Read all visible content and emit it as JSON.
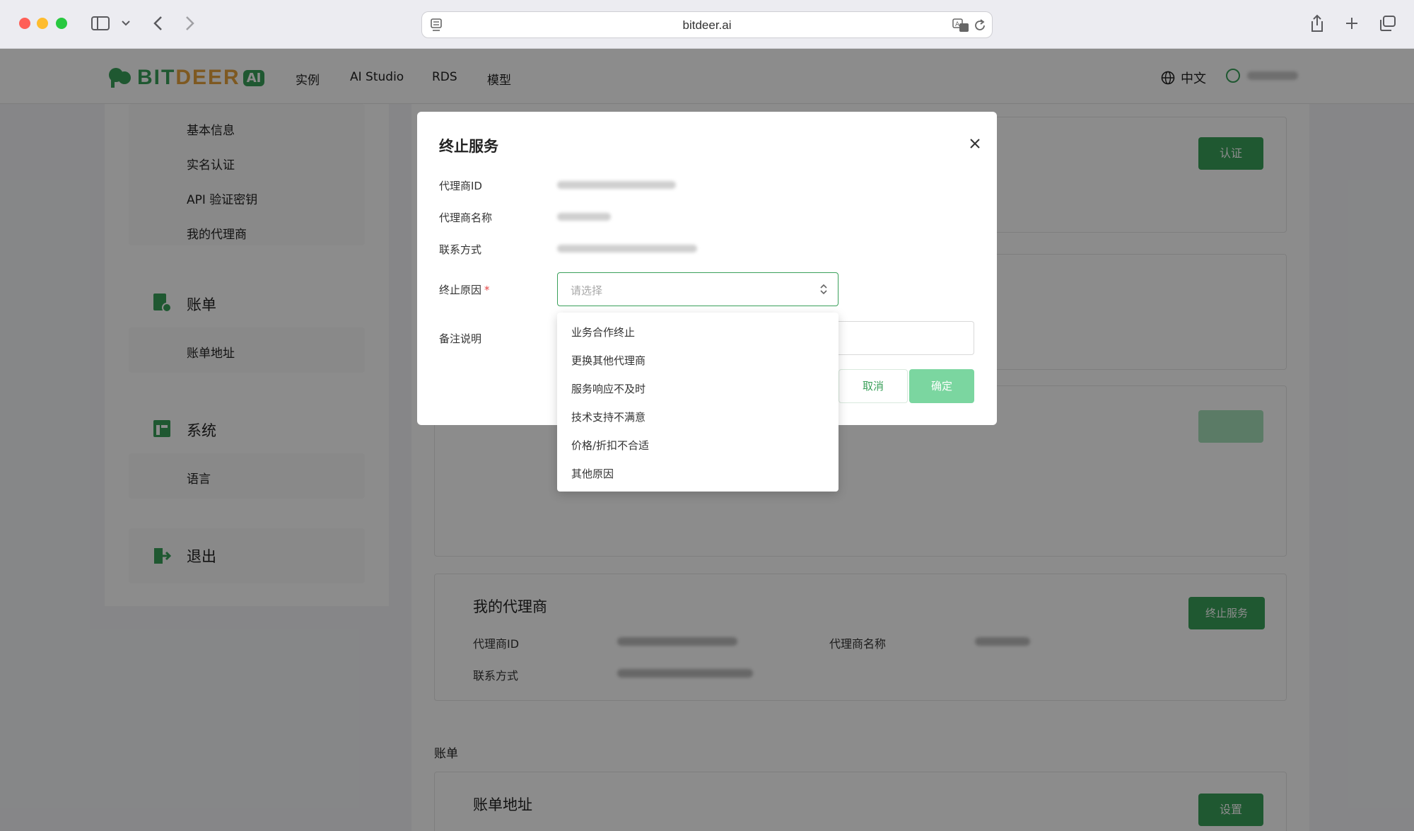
{
  "browser": {
    "url": "bitdeer.ai"
  },
  "site": {
    "logo": {
      "bit": "BIT",
      "deer": "DEER",
      "ai": "AI"
    },
    "nav": [
      "实例",
      "AI Studio",
      "RDS",
      "模型"
    ],
    "language": "中文"
  },
  "sidebar": {
    "account_items": [
      "基本信息",
      "实名认证",
      "API 验证密钥",
      "我的代理商"
    ],
    "billing_head": "账单",
    "billing_items": [
      "账单地址"
    ],
    "system_head": "系统",
    "system_items": [
      "语言"
    ],
    "logout": "退出"
  },
  "content": {
    "verify_button": "认证",
    "agent_card": {
      "title": "我的代理商",
      "id_label": "代理商ID",
      "name_label": "代理商名称",
      "contact_label": "联系方式",
      "terminate_button": "终止服务"
    },
    "billing_section": "账单",
    "billing_card": {
      "title": "账单地址",
      "button": "设置"
    }
  },
  "modal": {
    "title": "终止服务",
    "fields": {
      "agent_id_label": "代理商ID",
      "agent_name_label": "代理商名称",
      "contact_label": "联系方式",
      "reason_label": "终止原因",
      "required_mark": "*",
      "note_label": "备注说明"
    },
    "select_placeholder": "请选择",
    "cancel": "取消",
    "confirm": "确定",
    "reason_options": [
      "业务合作终止",
      "更换其他代理商",
      "服务响应不及时",
      "技术支持不满意",
      "价格/折扣不合适",
      "其他原因"
    ]
  },
  "colors": {
    "brand_green": "#3aa05a",
    "brand_orange": "#e6a23c",
    "confirm_light_green": "#7bd6a0",
    "required_red": "#e54545"
  },
  "icons": [
    "sidebar-toggle-icon",
    "back-icon",
    "forward-icon",
    "page-icon",
    "translate-icon",
    "reload-icon",
    "share-icon",
    "new-tab-icon",
    "tabs-overview-icon",
    "globe-icon",
    "user-icon",
    "bill-icon",
    "system-icon",
    "logout-icon",
    "close-icon",
    "select-arrows-icon"
  ]
}
